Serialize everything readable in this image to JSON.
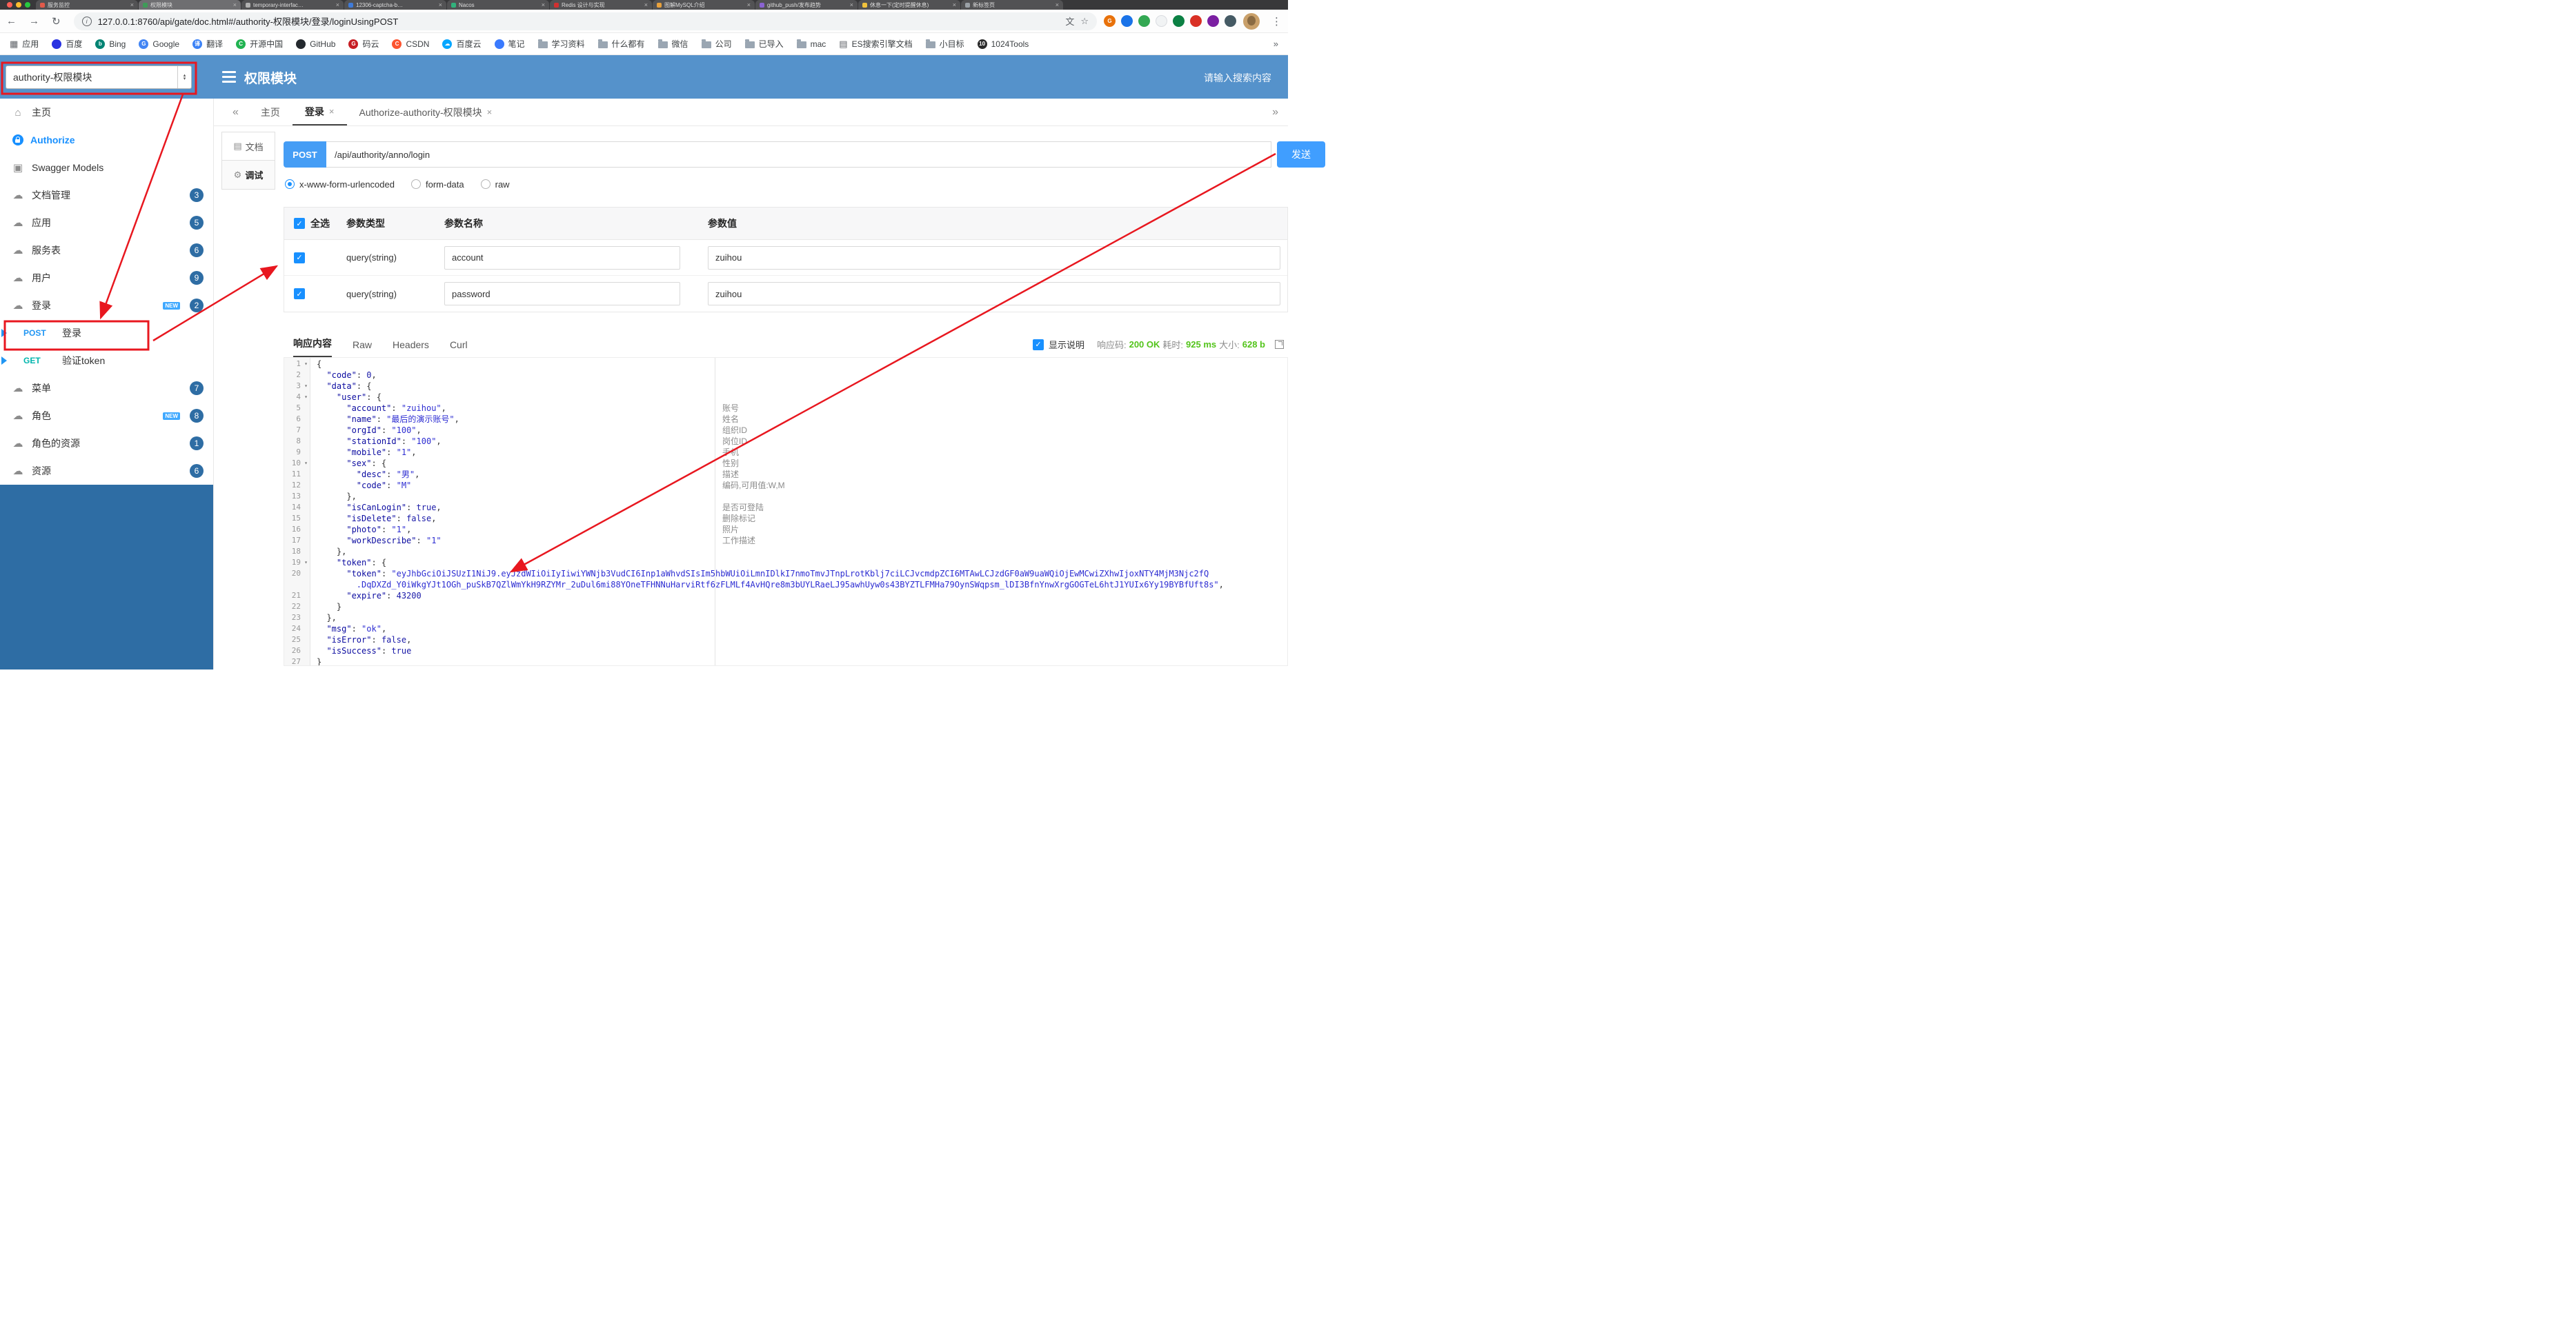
{
  "icons": {
    "close": "×",
    "back": "←",
    "forward": "→",
    "reload": "↻",
    "kebab": "⋮",
    "prev": "«",
    "next": "»",
    "home": "⌂",
    "cloud": "☁",
    "models": "▣",
    "star": "☆",
    "translate": "文",
    "apps": "▦",
    "doc": "▤",
    "doc_tab": "▤",
    "debug_tab": "⚙",
    "fold": "▾",
    "check": "✓",
    "spin_up": "▴",
    "spin_down": "▾",
    "info": "i"
  },
  "colors": {
    "red_annotation": "#e8171f",
    "header_blue": "#5592cb",
    "dark_blue": "#2e6da4",
    "accent": "#409eff",
    "success_green": "#52c41a",
    "method": {
      "POST": "#2196f3",
      "GET": "#00b5ad"
    }
  },
  "browser": {
    "url": "127.0.0.1:8760/api/gate/doc.html#/authority-权限模块/登录/loginUsingPOST",
    "tabs": [
      {
        "title": "服务监控",
        "fav": "#e25a4a"
      },
      {
        "title": "权限模块",
        "fav": "#3f9b58",
        "active": true
      },
      {
        "title": "temporary-interfac…",
        "fav": "#b0b0b0"
      },
      {
        "title": "12306-captcha-b…",
        "fav": "#3f7bd9"
      },
      {
        "title": "Nacos",
        "fav": "#31b27c"
      },
      {
        "title": "Redis 设计与实现",
        "fav": "#d13030"
      },
      {
        "title": "图解MySQL介绍",
        "fav": "#e8a13c"
      },
      {
        "title": "github_push/发布趋势",
        "fav": "#8a63d2"
      },
      {
        "title": "休息一下(定时提醒休息)",
        "fav": "#f0c23c"
      },
      {
        "title": "新标签页",
        "fav": "#9aa0a6"
      }
    ],
    "extensions": [
      {
        "color": "#e8710a",
        "letter": "G"
      },
      {
        "color": "#1a73e8",
        "letter": ""
      },
      {
        "color": "#34a853",
        "letter": ""
      },
      {
        "color": "#f1f3f4",
        "letter": "",
        "border": "#dadce0"
      },
      {
        "color": "#0b8043",
        "letter": ""
      },
      {
        "color": "#d93025",
        "letter": ""
      },
      {
        "color": "#7b1fa2",
        "letter": ""
      },
      {
        "color": "#455a64",
        "letter": ""
      }
    ],
    "bookmarks": [
      {
        "label": "应用",
        "icon": "apps"
      },
      {
        "label": "百度",
        "icon": "dot",
        "color": "#2932e1",
        "letter": ""
      },
      {
        "label": "Bing",
        "icon": "dot",
        "color": "#008373",
        "letter": "b"
      },
      {
        "label": "Google",
        "icon": "dot",
        "color": "#4285f4",
        "letter": "G"
      },
      {
        "label": "翻译",
        "icon": "dot",
        "color": "#3b82f6",
        "letter": "译"
      },
      {
        "label": "开源中国",
        "icon": "dot",
        "color": "#21b351",
        "letter": "C"
      },
      {
        "label": "GitHub",
        "icon": "dot",
        "color": "#24292e",
        "letter": ""
      },
      {
        "label": "码云",
        "icon": "dot",
        "color": "#c71d23",
        "letter": "G"
      },
      {
        "label": "CSDN",
        "icon": "dot",
        "color": "#fc5531",
        "letter": "C"
      },
      {
        "label": "百度云",
        "icon": "dot",
        "color": "#06a7ff",
        "letter": "☁"
      },
      {
        "label": "笔记",
        "icon": "dot",
        "color": "#3a7afe",
        "letter": ""
      },
      {
        "label": "学习资料",
        "icon": "folder"
      },
      {
        "label": "什么都有",
        "icon": "folder"
      },
      {
        "label": "微信",
        "icon": "folder"
      },
      {
        "label": "公司",
        "icon": "folder"
      },
      {
        "label": "已导入",
        "icon": "folder"
      },
      {
        "label": "mac",
        "icon": "folder"
      },
      {
        "label": "ES搜索引擎文档",
        "icon": "doc"
      },
      {
        "label": "小目标",
        "icon": "folder"
      },
      {
        "label": "1024Tools",
        "icon": "dot",
        "color": "#2b2b2b",
        "letter": "10"
      }
    ]
  },
  "header": {
    "module_select": "authority-权限模块",
    "title": "权限模块",
    "search_placeholder": "请输入搜索内容"
  },
  "sidebar": {
    "new_label": "NEW",
    "items": [
      {
        "kind": "item",
        "icon": "home",
        "label": "主页"
      },
      {
        "kind": "item",
        "icon": "auth",
        "label": "Authorize",
        "accent": true
      },
      {
        "kind": "item",
        "icon": "models",
        "label": "Swagger Models"
      },
      {
        "kind": "item",
        "icon": "group",
        "label": "文档管理",
        "badge": "3"
      },
      {
        "kind": "item",
        "icon": "group",
        "label": "应用",
        "badge": "5"
      },
      {
        "kind": "item",
        "icon": "group",
        "label": "服务表",
        "badge": "6"
      },
      {
        "kind": "item",
        "icon": "group",
        "label": "用户",
        "badge": "9"
      },
      {
        "kind": "item",
        "icon": "group",
        "label": "登录",
        "badge": "2",
        "isNew": true
      },
      {
        "kind": "sub",
        "method": "POST",
        "label": "登录",
        "selected": true
      },
      {
        "kind": "sub",
        "method": "GET",
        "label": "验证token"
      },
      {
        "kind": "item",
        "icon": "group",
        "label": "菜单",
        "badge": "7"
      },
      {
        "kind": "item",
        "icon": "group",
        "label": "角色",
        "badge": "8",
        "isNew": true
      },
      {
        "kind": "item",
        "icon": "group",
        "label": "角色的资源",
        "badge": "1"
      },
      {
        "kind": "item",
        "icon": "group",
        "label": "资源",
        "badge": "6"
      }
    ]
  },
  "doc_tabs": [
    {
      "label": "主页",
      "closable": false
    },
    {
      "label": "登录",
      "closable": true,
      "active": true
    },
    {
      "label": "Authorize-authority-权限模块",
      "closable": true
    }
  ],
  "mini_tabs": [
    {
      "label": "文档",
      "icon": "doc_tab"
    },
    {
      "label": "调试",
      "icon": "debug_tab",
      "active": true
    }
  ],
  "debug": {
    "method": "POST",
    "url": "/api/authority/anno/login",
    "send_label": "发送",
    "body_types": [
      "x-www-form-urlencoded",
      "form-data",
      "raw"
    ],
    "body_type_selected": 0
  },
  "param_table": {
    "headers": [
      "全选",
      "参数类型",
      "参数名称",
      "参数值"
    ],
    "rows": [
      {
        "checked": true,
        "type": "query(string)",
        "name": "account",
        "value": "zuihou"
      },
      {
        "checked": true,
        "type": "query(string)",
        "name": "password",
        "value": "zuihou"
      }
    ]
  },
  "response": {
    "tabs": [
      "响应内容",
      "Raw",
      "Headers",
      "Curl"
    ],
    "show_desc_label": "显示说明",
    "meta": {
      "code_label": "响应码:",
      "code": "200 OK",
      "time_label": "耗时:",
      "time": "925 ms",
      "size_label": "大小:",
      "size": "628 b"
    }
  },
  "response_body": {
    "language": "json",
    "rows": [
      {
        "n": "1",
        "fold": true,
        "t": [
          [
            "pl",
            "{"
          ]
        ]
      },
      {
        "n": "2",
        "t": [
          [
            "pl",
            "  "
          ],
          [
            "key",
            "\"code\""
          ],
          [
            "pl",
            ": "
          ],
          [
            "num",
            "0"
          ],
          [
            "pl",
            ","
          ]
        ]
      },
      {
        "n": "3",
        "fold": true,
        "t": [
          [
            "pl",
            "  "
          ],
          [
            "key",
            "\"data\""
          ],
          [
            "pl",
            ": {"
          ]
        ]
      },
      {
        "n": "4",
        "fold": true,
        "t": [
          [
            "pl",
            "    "
          ],
          [
            "key",
            "\"user\""
          ],
          [
            "pl",
            ": {"
          ]
        ]
      },
      {
        "n": "5",
        "note": "账号",
        "t": [
          [
            "pl",
            "      "
          ],
          [
            "key",
            "\"account\""
          ],
          [
            "pl",
            ": "
          ],
          [
            "str",
            "\"zuihou\""
          ],
          [
            "pl",
            ","
          ]
        ]
      },
      {
        "n": "6",
        "note": "姓名",
        "t": [
          [
            "pl",
            "      "
          ],
          [
            "key",
            "\"name\""
          ],
          [
            "pl",
            ": "
          ],
          [
            "str",
            "\"最后的演示账号\""
          ],
          [
            "pl",
            ","
          ]
        ]
      },
      {
        "n": "7",
        "note": "组织ID",
        "t": [
          [
            "pl",
            "      "
          ],
          [
            "key",
            "\"orgId\""
          ],
          [
            "pl",
            ": "
          ],
          [
            "str",
            "\"100\""
          ],
          [
            "pl",
            ","
          ]
        ]
      },
      {
        "n": "8",
        "note": "岗位ID",
        "t": [
          [
            "pl",
            "      "
          ],
          [
            "key",
            "\"stationId\""
          ],
          [
            "pl",
            ": "
          ],
          [
            "str",
            "\"100\""
          ],
          [
            "pl",
            ","
          ]
        ]
      },
      {
        "n": "9",
        "note": "手机",
        "t": [
          [
            "pl",
            "      "
          ],
          [
            "key",
            "\"mobile\""
          ],
          [
            "pl",
            ": "
          ],
          [
            "str",
            "\"1\""
          ],
          [
            "pl",
            ","
          ]
        ]
      },
      {
        "n": "10",
        "fold": true,
        "note": "性别",
        "t": [
          [
            "pl",
            "      "
          ],
          [
            "key",
            "\"sex\""
          ],
          [
            "pl",
            ": {"
          ]
        ]
      },
      {
        "n": "11",
        "note": "描述",
        "t": [
          [
            "pl",
            "        "
          ],
          [
            "key",
            "\"desc\""
          ],
          [
            "pl",
            ": "
          ],
          [
            "str",
            "\"男\""
          ],
          [
            "pl",
            ","
          ]
        ]
      },
      {
        "n": "12",
        "note": "编码,可用值:W,M",
        "t": [
          [
            "pl",
            "        "
          ],
          [
            "key",
            "\"code\""
          ],
          [
            "pl",
            ": "
          ],
          [
            "str",
            "\"M\""
          ]
        ]
      },
      {
        "n": "13",
        "t": [
          [
            "pl",
            "      },"
          ]
        ]
      },
      {
        "n": "14",
        "note": "是否可登陆",
        "t": [
          [
            "pl",
            "      "
          ],
          [
            "key",
            "\"isCanLogin\""
          ],
          [
            "pl",
            ": "
          ],
          [
            "atom",
            "true"
          ],
          [
            "pl",
            ","
          ]
        ]
      },
      {
        "n": "15",
        "note": "删除标记",
        "t": [
          [
            "pl",
            "      "
          ],
          [
            "key",
            "\"isDelete\""
          ],
          [
            "pl",
            ": "
          ],
          [
            "atom",
            "false"
          ],
          [
            "pl",
            ","
          ]
        ]
      },
      {
        "n": "16",
        "note": "照片",
        "t": [
          [
            "pl",
            "      "
          ],
          [
            "key",
            "\"photo\""
          ],
          [
            "pl",
            ": "
          ],
          [
            "str",
            "\"1\""
          ],
          [
            "pl",
            ","
          ]
        ]
      },
      {
        "n": "17",
        "note": "工作描述",
        "t": [
          [
            "pl",
            "      "
          ],
          [
            "key",
            "\"workDescribe\""
          ],
          [
            "pl",
            ": "
          ],
          [
            "str",
            "\"1\""
          ]
        ]
      },
      {
        "n": "18",
        "t": [
          [
            "pl",
            "    },"
          ]
        ]
      },
      {
        "n": "19",
        "fold": true,
        "t": [
          [
            "pl",
            "    "
          ],
          [
            "key",
            "\"token\""
          ],
          [
            "pl",
            ": {"
          ]
        ]
      },
      {
        "n": "20",
        "t": [
          [
            "pl",
            "      "
          ],
          [
            "key",
            "\"token\""
          ],
          [
            "pl",
            ": "
          ],
          [
            "str",
            "\"eyJhbGciOiJSUzI1NiJ9.eyJzdWIiOiIyIiwiYWNjb3VudCI6Inp1aWhvdSIsIm5hbWUiOiLmnIDlkI7nmoTmvJTnpLrotKblj7ciLCJvcmdpZCI6MTAwLCJzdGF0aW9uaWQiOjEwMCwiZXhwIjoxNTY4MjM3Njc2fQ"
          ]
        ]
      },
      {
        "n": "",
        "t": [
          [
            "pl",
            "        "
          ],
          [
            "str",
            ".DqDXZd_Y0iWkgYJt1OGh_puSkB7QZlWmYkH9RZYMr_2uDul6mi88YOneTFHNNuHarviRtf6zFLMLf4AvHQre8m3bUYLRaeLJ95awhUyw0s43BYZTLFMHa79OynSWqpsm_lDI3BfnYnwXrgGOGTeL6htJ1YUIx6Yy19BYBfUft8s\""
          ],
          [
            "pl",
            ","
          ]
        ]
      },
      {
        "n": "21",
        "t": [
          [
            "pl",
            "      "
          ],
          [
            "key",
            "\"expire\""
          ],
          [
            "pl",
            ": "
          ],
          [
            "num",
            "43200"
          ]
        ]
      },
      {
        "n": "22",
        "t": [
          [
            "pl",
            "    }"
          ]
        ]
      },
      {
        "n": "23",
        "t": [
          [
            "pl",
            "  },"
          ]
        ]
      },
      {
        "n": "24",
        "t": [
          [
            "pl",
            "  "
          ],
          [
            "key",
            "\"msg\""
          ],
          [
            "pl",
            ": "
          ],
          [
            "str",
            "\"ok\""
          ],
          [
            "pl",
            ","
          ]
        ]
      },
      {
        "n": "25",
        "t": [
          [
            "pl",
            "  "
          ],
          [
            "key",
            "\"isError\""
          ],
          [
            "pl",
            ": "
          ],
          [
            "atom",
            "false"
          ],
          [
            "pl",
            ","
          ]
        ]
      },
      {
        "n": "26",
        "t": [
          [
            "pl",
            "  "
          ],
          [
            "key",
            "\"isSuccess\""
          ],
          [
            "pl",
            ": "
          ],
          [
            "atom",
            "true"
          ]
        ]
      },
      {
        "n": "27",
        "t": [
          [
            "pl",
            "}"
          ]
        ]
      }
    ]
  }
}
